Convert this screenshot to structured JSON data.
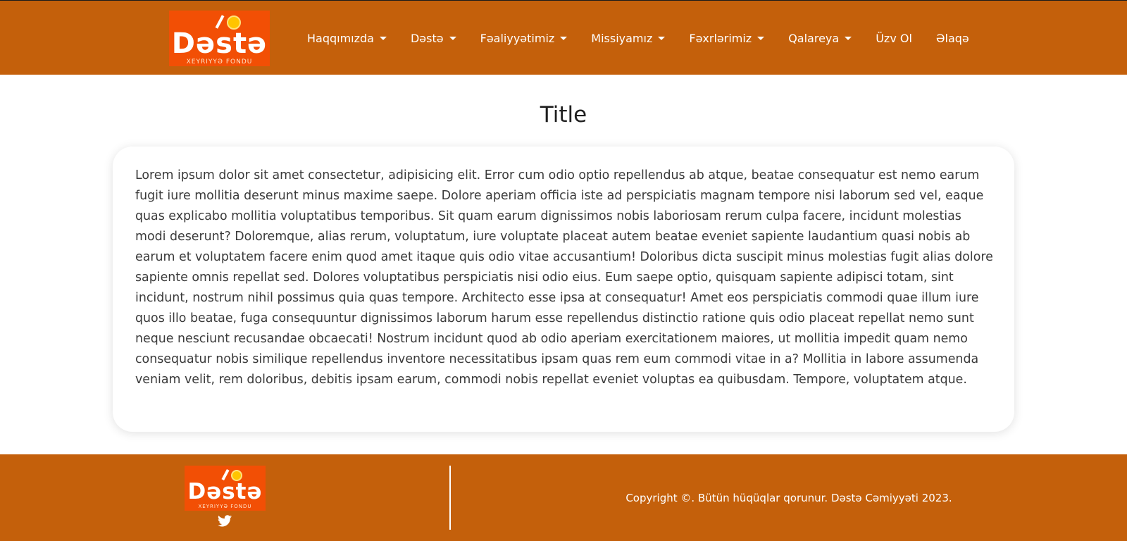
{
  "header": {
    "logo": {
      "brand": "Dəstə",
      "subtitle": "XEYRIYYƏ FONDU"
    },
    "nav": [
      {
        "label": "Haqqımızda",
        "dropdown": true
      },
      {
        "label": "Dəstə",
        "dropdown": true
      },
      {
        "label": "Fəaliyyətimiz",
        "dropdown": true
      },
      {
        "label": "Missiyamız",
        "dropdown": true
      },
      {
        "label": "Fəxrlərimiz",
        "dropdown": true
      },
      {
        "label": "Qalareya",
        "dropdown": true
      },
      {
        "label": "Üzv Ol",
        "dropdown": false
      },
      {
        "label": "Əlaqə",
        "dropdown": false
      }
    ]
  },
  "main": {
    "title": "Title",
    "body": "Lorem ipsum dolor sit amet consectetur, adipisicing elit. Error cum odio optio repellendus ab atque, beatae consequatur est nemo earum fugit iure mollitia deserunt minus maxime saepe. Dolore aperiam officia iste ad perspiciatis magnam tempore nisi laborum sed vel, eaque quas explicabo mollitia voluptatibus temporibus. Sit quam earum dignissimos nobis laboriosam rerum culpa facere, incidunt molestias modi deserunt? Doloremque, alias rerum, voluptatum, iure voluptate placeat autem beatae eveniet sapiente laudantium quasi nobis ab earum et voluptatem facere enim quod amet itaque quis odio vitae accusantium! Doloribus dicta suscipit minus molestias fugit alias dolore sapiente omnis repellat sed. Dolores voluptatibus perspiciatis nisi odio eius. Eum saepe optio, quisquam sapiente adipisci totam, sint incidunt, nostrum nihil possimus quia quas tempore. Architecto esse ipsa at consequatur! Amet eos perspiciatis commodi quae illum iure quos illo beatae, fuga consequuntur dignissimos laborum harum esse repellendus distinctio ratione quis odio placeat repellat nemo sunt neque nesciunt recusandae obcaecati! Nostrum incidunt quod ab odio aperiam exercitationem maiores, ut mollitia impedit quam nemo consequatur nobis similique repellendus inventore necessitatibus ipsam quas rem eum commodi vitae in a? Mollitia in labore assumenda veniam velit, rem doloribus, debitis ipsam earum, commodi nobis repellat eveniet voluptas ea quibusdam. Tempore, voluptatem atque."
  },
  "footer": {
    "logo": {
      "brand": "Dəstə",
      "subtitle": "XEYRIYYƏ FONDU"
    },
    "social_icon": "twitter-icon",
    "copyright": "Copyright ©. Bütün hüqüqlar qorunur. Dəstə Cəmiyyəti 2023."
  },
  "colors": {
    "primary": "#c4600b",
    "logo_background": "#f24f05",
    "text": "#3a3a3a"
  }
}
